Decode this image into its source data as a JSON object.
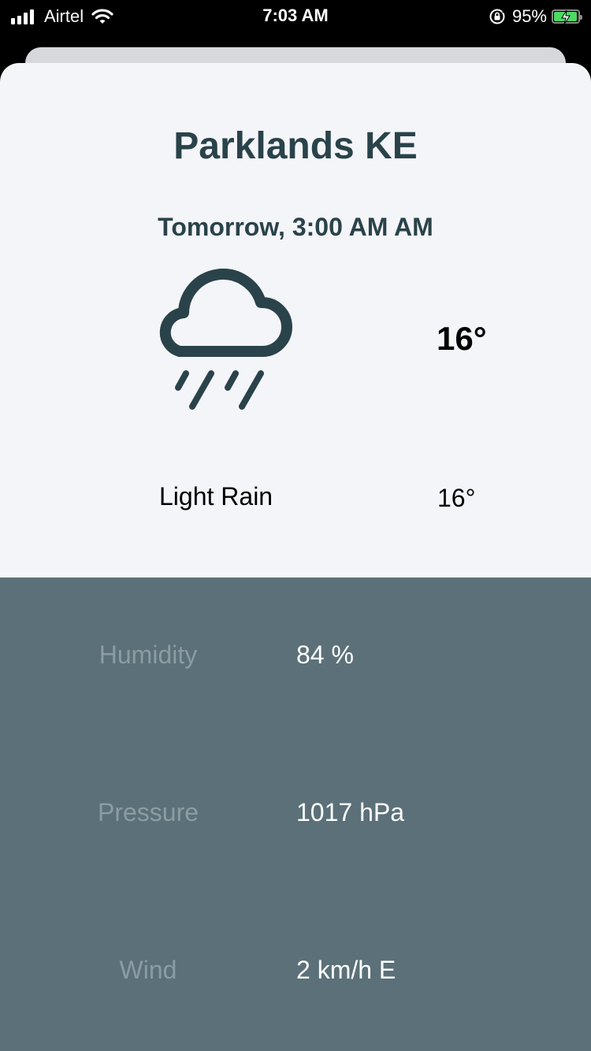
{
  "status_bar": {
    "carrier": "Airtel",
    "time": "7:03 AM",
    "battery_percent": "95%",
    "battery_level": 0.95,
    "icons": [
      "signal-icon",
      "wifi-icon",
      "orientation-lock-icon",
      "battery-charging-icon"
    ]
  },
  "forecast": {
    "location": "Parklands KE",
    "datetime": "Tomorrow, 3:00 AM AM",
    "icon": "cloud-rain-icon",
    "temperature": "16°",
    "condition": "Light Rain",
    "temperature_secondary": "16°"
  },
  "details": [
    {
      "label": "Humidity",
      "value": "84 %"
    },
    {
      "label": "Pressure",
      "value": "1017 hPa"
    },
    {
      "label": "Wind",
      "value": "2 km/h E"
    }
  ],
  "colors": {
    "heading": "#2a434a",
    "sheet_bg": "#f4f5f9",
    "details_bg": "#5b7079",
    "details_label": "#8c9ca3",
    "details_value": "#ffffff"
  }
}
